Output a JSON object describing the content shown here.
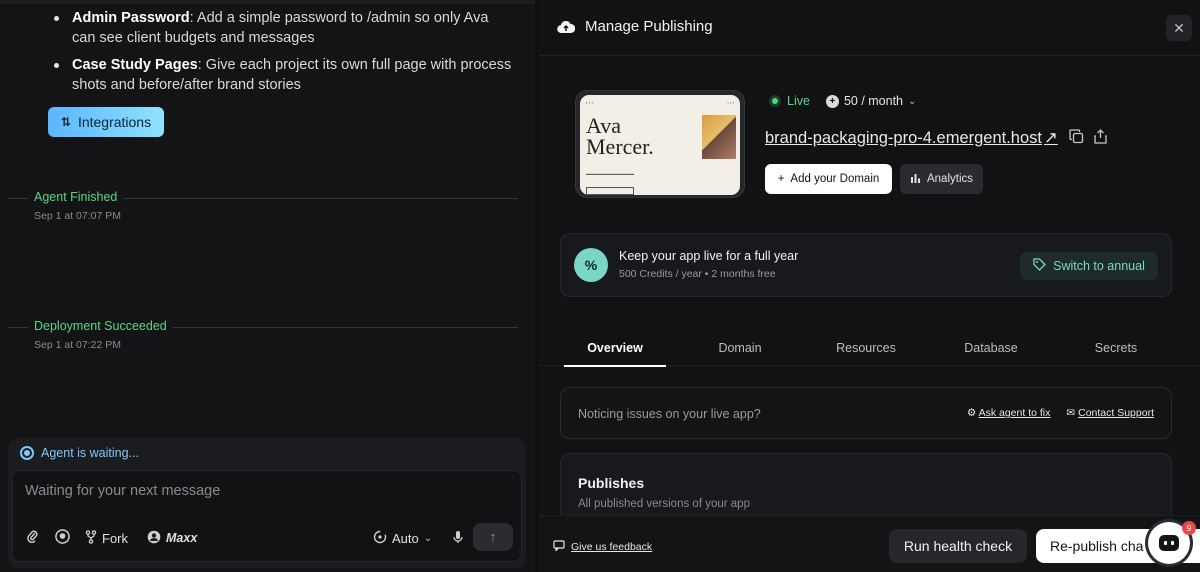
{
  "left": {
    "bullets": [
      {
        "title": "Admin Password",
        "text": ": Add a simple password to /admin so only Ava can see client budgets and messages"
      },
      {
        "title": "Case Study Pages",
        "text": ": Give each project its own full page with process shots and before/after brand stories"
      }
    ],
    "integrations_label": "Integrations",
    "events": [
      {
        "label": "Agent Finished",
        "time": "Sep 1 at 07:07 PM"
      },
      {
        "label": "Deployment Succeeded",
        "time": "Sep 1 at 07:22 PM"
      }
    ],
    "composer": {
      "status": "Agent is waiting...",
      "placeholder": "Waiting for your next message",
      "fork_label": "Fork",
      "maxx_label": "Maxx",
      "mode_label": "Auto"
    }
  },
  "right": {
    "title": "Manage Publishing",
    "preview": {
      "headline_line1": "Ava",
      "headline_line2": "Mercer."
    },
    "status": "Live",
    "credits": "50 / month",
    "domain": "brand-packaging-pro-4.emergent.host",
    "add_domain_label": "Add your Domain",
    "analytics_label": "Analytics",
    "annual": {
      "title": "Keep your app live for a full year",
      "subtitle": "500 Credits / year • 2 months free",
      "button": "Switch to annual"
    },
    "tabs": [
      "Overview",
      "Domain",
      "Resources",
      "Database",
      "Secrets"
    ],
    "issues": {
      "text": "Noticing issues on your live app?",
      "ask_agent": "Ask agent to fix",
      "contact": "Contact Support"
    },
    "publishes": {
      "title": "Publishes",
      "subtitle": "All published versions of your app"
    },
    "footer": {
      "feedback": "Give us feedback",
      "health_check": "Run health check",
      "republish": "Re-publish cha"
    }
  },
  "chat": {
    "badge": "9"
  },
  "colors": {
    "accent_green": "#5ad687",
    "accent_blue": "#7fc7ff",
    "teal": "#7ad6c6"
  }
}
